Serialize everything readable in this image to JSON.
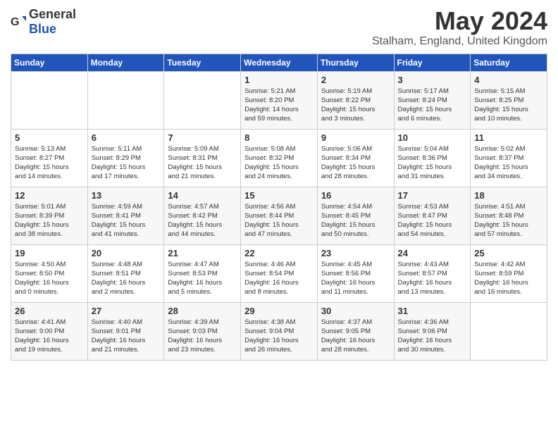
{
  "header": {
    "logo_general": "General",
    "logo_blue": "Blue",
    "month": "May 2024",
    "location": "Stalham, England, United Kingdom"
  },
  "days_of_week": [
    "Sunday",
    "Monday",
    "Tuesday",
    "Wednesday",
    "Thursday",
    "Friday",
    "Saturday"
  ],
  "weeks": [
    [
      {
        "day": "",
        "info": ""
      },
      {
        "day": "",
        "info": ""
      },
      {
        "day": "",
        "info": ""
      },
      {
        "day": "1",
        "info": "Sunrise: 5:21 AM\nSunset: 8:20 PM\nDaylight: 14 hours\nand 59 minutes."
      },
      {
        "day": "2",
        "info": "Sunrise: 5:19 AM\nSunset: 8:22 PM\nDaylight: 15 hours\nand 3 minutes."
      },
      {
        "day": "3",
        "info": "Sunrise: 5:17 AM\nSunset: 8:24 PM\nDaylight: 15 hours\nand 6 minutes."
      },
      {
        "day": "4",
        "info": "Sunrise: 5:15 AM\nSunset: 8:25 PM\nDaylight: 15 hours\nand 10 minutes."
      }
    ],
    [
      {
        "day": "5",
        "info": "Sunrise: 5:13 AM\nSunset: 8:27 PM\nDaylight: 15 hours\nand 14 minutes."
      },
      {
        "day": "6",
        "info": "Sunrise: 5:11 AM\nSunset: 8:29 PM\nDaylight: 15 hours\nand 17 minutes."
      },
      {
        "day": "7",
        "info": "Sunrise: 5:09 AM\nSunset: 8:31 PM\nDaylight: 15 hours\nand 21 minutes."
      },
      {
        "day": "8",
        "info": "Sunrise: 5:08 AM\nSunset: 8:32 PM\nDaylight: 15 hours\nand 24 minutes."
      },
      {
        "day": "9",
        "info": "Sunrise: 5:06 AM\nSunset: 8:34 PM\nDaylight: 15 hours\nand 28 minutes."
      },
      {
        "day": "10",
        "info": "Sunrise: 5:04 AM\nSunset: 8:36 PM\nDaylight: 15 hours\nand 31 minutes."
      },
      {
        "day": "11",
        "info": "Sunrise: 5:02 AM\nSunset: 8:37 PM\nDaylight: 15 hours\nand 34 minutes."
      }
    ],
    [
      {
        "day": "12",
        "info": "Sunrise: 5:01 AM\nSunset: 8:39 PM\nDaylight: 15 hours\nand 38 minutes."
      },
      {
        "day": "13",
        "info": "Sunrise: 4:59 AM\nSunset: 8:41 PM\nDaylight: 15 hours\nand 41 minutes."
      },
      {
        "day": "14",
        "info": "Sunrise: 4:57 AM\nSunset: 8:42 PM\nDaylight: 15 hours\nand 44 minutes."
      },
      {
        "day": "15",
        "info": "Sunrise: 4:56 AM\nSunset: 8:44 PM\nDaylight: 15 hours\nand 47 minutes."
      },
      {
        "day": "16",
        "info": "Sunrise: 4:54 AM\nSunset: 8:45 PM\nDaylight: 15 hours\nand 50 minutes."
      },
      {
        "day": "17",
        "info": "Sunrise: 4:53 AM\nSunset: 8:47 PM\nDaylight: 15 hours\nand 54 minutes."
      },
      {
        "day": "18",
        "info": "Sunrise: 4:51 AM\nSunset: 8:48 PM\nDaylight: 15 hours\nand 57 minutes."
      }
    ],
    [
      {
        "day": "19",
        "info": "Sunrise: 4:50 AM\nSunset: 8:50 PM\nDaylight: 16 hours\nand 0 minutes."
      },
      {
        "day": "20",
        "info": "Sunrise: 4:48 AM\nSunset: 8:51 PM\nDaylight: 16 hours\nand 2 minutes."
      },
      {
        "day": "21",
        "info": "Sunrise: 4:47 AM\nSunset: 8:53 PM\nDaylight: 16 hours\nand 5 minutes."
      },
      {
        "day": "22",
        "info": "Sunrise: 4:46 AM\nSunset: 8:54 PM\nDaylight: 16 hours\nand 8 minutes."
      },
      {
        "day": "23",
        "info": "Sunrise: 4:45 AM\nSunset: 8:56 PM\nDaylight: 16 hours\nand 11 minutes."
      },
      {
        "day": "24",
        "info": "Sunrise: 4:43 AM\nSunset: 8:57 PM\nDaylight: 16 hours\nand 13 minutes."
      },
      {
        "day": "25",
        "info": "Sunrise: 4:42 AM\nSunset: 8:59 PM\nDaylight: 16 hours\nand 16 minutes."
      }
    ],
    [
      {
        "day": "26",
        "info": "Sunrise: 4:41 AM\nSunset: 9:00 PM\nDaylight: 16 hours\nand 19 minutes."
      },
      {
        "day": "27",
        "info": "Sunrise: 4:40 AM\nSunset: 9:01 PM\nDaylight: 16 hours\nand 21 minutes."
      },
      {
        "day": "28",
        "info": "Sunrise: 4:39 AM\nSunset: 9:03 PM\nDaylight: 16 hours\nand 23 minutes."
      },
      {
        "day": "29",
        "info": "Sunrise: 4:38 AM\nSunset: 9:04 PM\nDaylight: 16 hours\nand 26 minutes."
      },
      {
        "day": "30",
        "info": "Sunrise: 4:37 AM\nSunset: 9:05 PM\nDaylight: 16 hours\nand 28 minutes."
      },
      {
        "day": "31",
        "info": "Sunrise: 4:36 AM\nSunset: 9:06 PM\nDaylight: 16 hours\nand 30 minutes."
      },
      {
        "day": "",
        "info": ""
      }
    ]
  ]
}
